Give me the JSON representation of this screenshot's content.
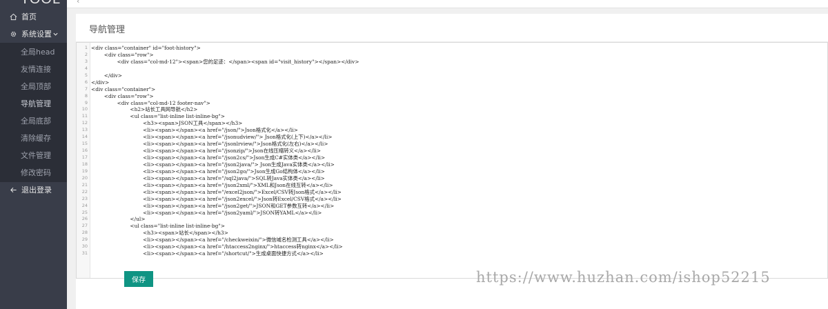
{
  "brand": "TOOL",
  "sidebar": {
    "home": "首页",
    "system": "系统设置",
    "items": [
      "全局head",
      "友情连接",
      "全局顶部",
      "导航管理",
      "全局底部",
      "清除缓存",
      "文件管理",
      "修改密码"
    ],
    "logout": "退出登录",
    "active_index": 3
  },
  "topbar": {
    "back_glyph": "‹"
  },
  "page": {
    "title": "导航管理",
    "save_label": "保存"
  },
  "editor": {
    "lines": [
      "<div class=\"container\" id=\"foot-history\">",
      "        <div class=\"row\">",
      "                <div class=\"col-md-12\"><span>您的足迹：</span><span id=\"visit_history\"></span></div>",
      "",
      "        </div>",
      "</div>",
      "<div class=\"container\">",
      "        <div class=\"row\">",
      "                <div class=\"col-md-12 footer-nav\">",
      "                        <h2>站长工具网导航</h2>",
      "                        <ul class=\"list-inline list-inline-bg\">",
      "                                <h3><span>JSON工具</span></h3>",
      "                                <li><span></span><a href=\"/json/\">Json格式化</a></li>",
      "                                <li><span></span><a href=\"/jsonudview/\"> Json格式化(上下)</a></li>",
      "                                <li><span></span><a href=\"/jsonlrview/\">Json格式化(左右)</a></li>",
      "                                <li><span></span><a href=\"/jsonzip/\">Json在线压缩转义</a></li>",
      "                                <li><span></span><a href=\"/json2cs/\">Json生成C#实体类</a></li>",
      "                                <li><span></span><a href=\"/json2java/\"> Json生成Java实体类</a></li>",
      "                                <li><span></span><a href=\"/json2go/\">Json生成Go结构体</a></li>",
      "                                <li><span></span><a href=\"/sql2java/\">SQL转Java实体类</a></li>",
      "                                <li><span></span><a href=\"/json2xml/\">XML和Json在线互转</a></li>",
      "                                <li><span></span><a href=\"/excel2json/\">Excel/CSV转Json格式</a></li>",
      "                                <li><span></span><a href=\"/json2excel/\">Json转Excel/CSV格式</a></li>",
      "                                <li><span></span><a href=\"/json2get/\">JSON和GET参数互转</a></li>",
      "                                <li><span></span><a href=\"/json2yaml/\">JSON转YAML</a></li>",
      "                        </ul>",
      "                        <ul class=\"list-inline list-inline-bg\">",
      "                                <h3><span>站长</span></h3>",
      "                                <li><span></span><a href=\"/checkweixin/\">微信域名检测工具</a></li>",
      "                                <li><span></span><a href=\"/htaccess2nginx/\">htaccess转nginx</a></li>",
      "                                <li><span></span><a href=\"/shortcut/\">生成桌面快捷方式</a></li>"
    ]
  },
  "watermark": "https://www.huzhan.com/ishop52215",
  "colors": {
    "sidebar": "#393d49",
    "submenu": "#2b2e37",
    "save_button": "#0f9483"
  }
}
